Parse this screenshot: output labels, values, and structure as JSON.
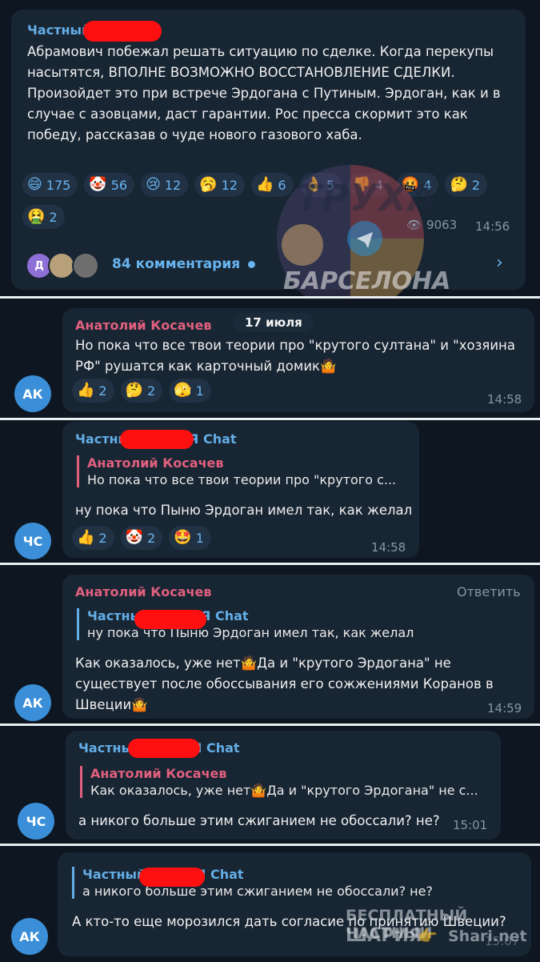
{
  "post": {
    "channel_name": "Частный ШАРИЯ",
    "text": "Абрамович побежал решать ситуацию по сделке. Когда перекупы насытятся, ВПОЛНЕ ВОЗМОЖНО ВОССТАНОВЛЕНИЕ СДЕЛКИ. Произойдет это при встрече Эрдогана с Путиным. Эрдоган, как и в случае с азовцами, даст гарантии. Рос пресса скормит это как победу, рассказав о чуде нового газового хаба.",
    "reactions": [
      {
        "emoji": "😄",
        "count": "175"
      },
      {
        "emoji": "🤡",
        "count": "56"
      },
      {
        "emoji": "😢",
        "count": "12"
      },
      {
        "emoji": "🥱",
        "count": "12"
      },
      {
        "emoji": "👍",
        "count": "6"
      },
      {
        "emoji": "👌",
        "count": "5"
      },
      {
        "emoji": "👎",
        "count": "4"
      },
      {
        "emoji": "🤬",
        "count": "4"
      },
      {
        "emoji": "🤔",
        "count": "2"
      },
      {
        "emoji": "🤮",
        "count": "2"
      }
    ],
    "views": "9063",
    "time": "14:56",
    "comments_label": "84 комментария",
    "commenter_initial": "Д"
  },
  "watermark": {
    "line1": "ТРУХА",
    "line2": "БАРСЕЛОНА"
  },
  "date_separator": "17 июля",
  "messages": [
    {
      "author": "Анатолий Косачев",
      "avatar": "АК",
      "text": "Но пока что все твои теории про \"крутого султана\" и \"хозяина РФ\" рушатся как карточный домик🤷",
      "reactions": [
        {
          "emoji": "👍",
          "count": "2"
        },
        {
          "emoji": "🤔",
          "count": "2"
        },
        {
          "emoji": "🫣",
          "count": "1"
        }
      ],
      "time": "14:58"
    },
    {
      "author": "Частный ШАРИЯ Chat",
      "avatar": "ЧС",
      "reply_author": "Анатолий Косачев",
      "reply_text": "Но пока что все твои теории про \"крутого с...",
      "text": "ну пока что Пыню Эрдоган имел так, как желал",
      "reactions": [
        {
          "emoji": "👍",
          "count": "2"
        },
        {
          "emoji": "🤡",
          "count": "2"
        },
        {
          "emoji": "🤩",
          "count": "1"
        }
      ],
      "time": "14:58"
    },
    {
      "author": "Анатолий Косачев",
      "avatar": "АК",
      "reply_button": "Ответить",
      "reply_author": "Частный ШАРИЯ Chat",
      "reply_text": "ну пока что Пыню Эрдоган имел так, как желал",
      "text": "Как оказалось, уже нет🤷Да и \"крутого Эрдогана\" не существует после обоссывания его сожжениями Коранов в Швеции🤷",
      "time": "14:59"
    },
    {
      "author": "Частный ШАРИЯ Chat",
      "avatar": "ЧС",
      "reply_author": "Анатолий Косачев",
      "reply_text": "Как оказалось, уже нет🤷Да и \"крутого Эрдогана\" не с...",
      "text": "а никого больше этим сжиганием не обоссали? не?",
      "time": "15:01"
    },
    {
      "avatar": "АК",
      "reply_author": "Частный ШАРИЯ Chat",
      "reply_text": "а никого больше этим сжиганием не обоссали? не?",
      "text": "А кто-то еще морозился дать согласие по принятию Швеции?",
      "time": "15:07"
    }
  ],
  "bottom_watermark": {
    "line1": "БЕСПЛАТНЫЙ ЧАСТНЫЙ",
    "line2": "ШАРИЯ",
    "line3": "Shari.net"
  },
  "colors": {
    "background": "#0e1621",
    "bubble": "#182533",
    "author_red": "#e0607e",
    "author_blue": "#63aee6",
    "redaction": "#ff1010"
  }
}
